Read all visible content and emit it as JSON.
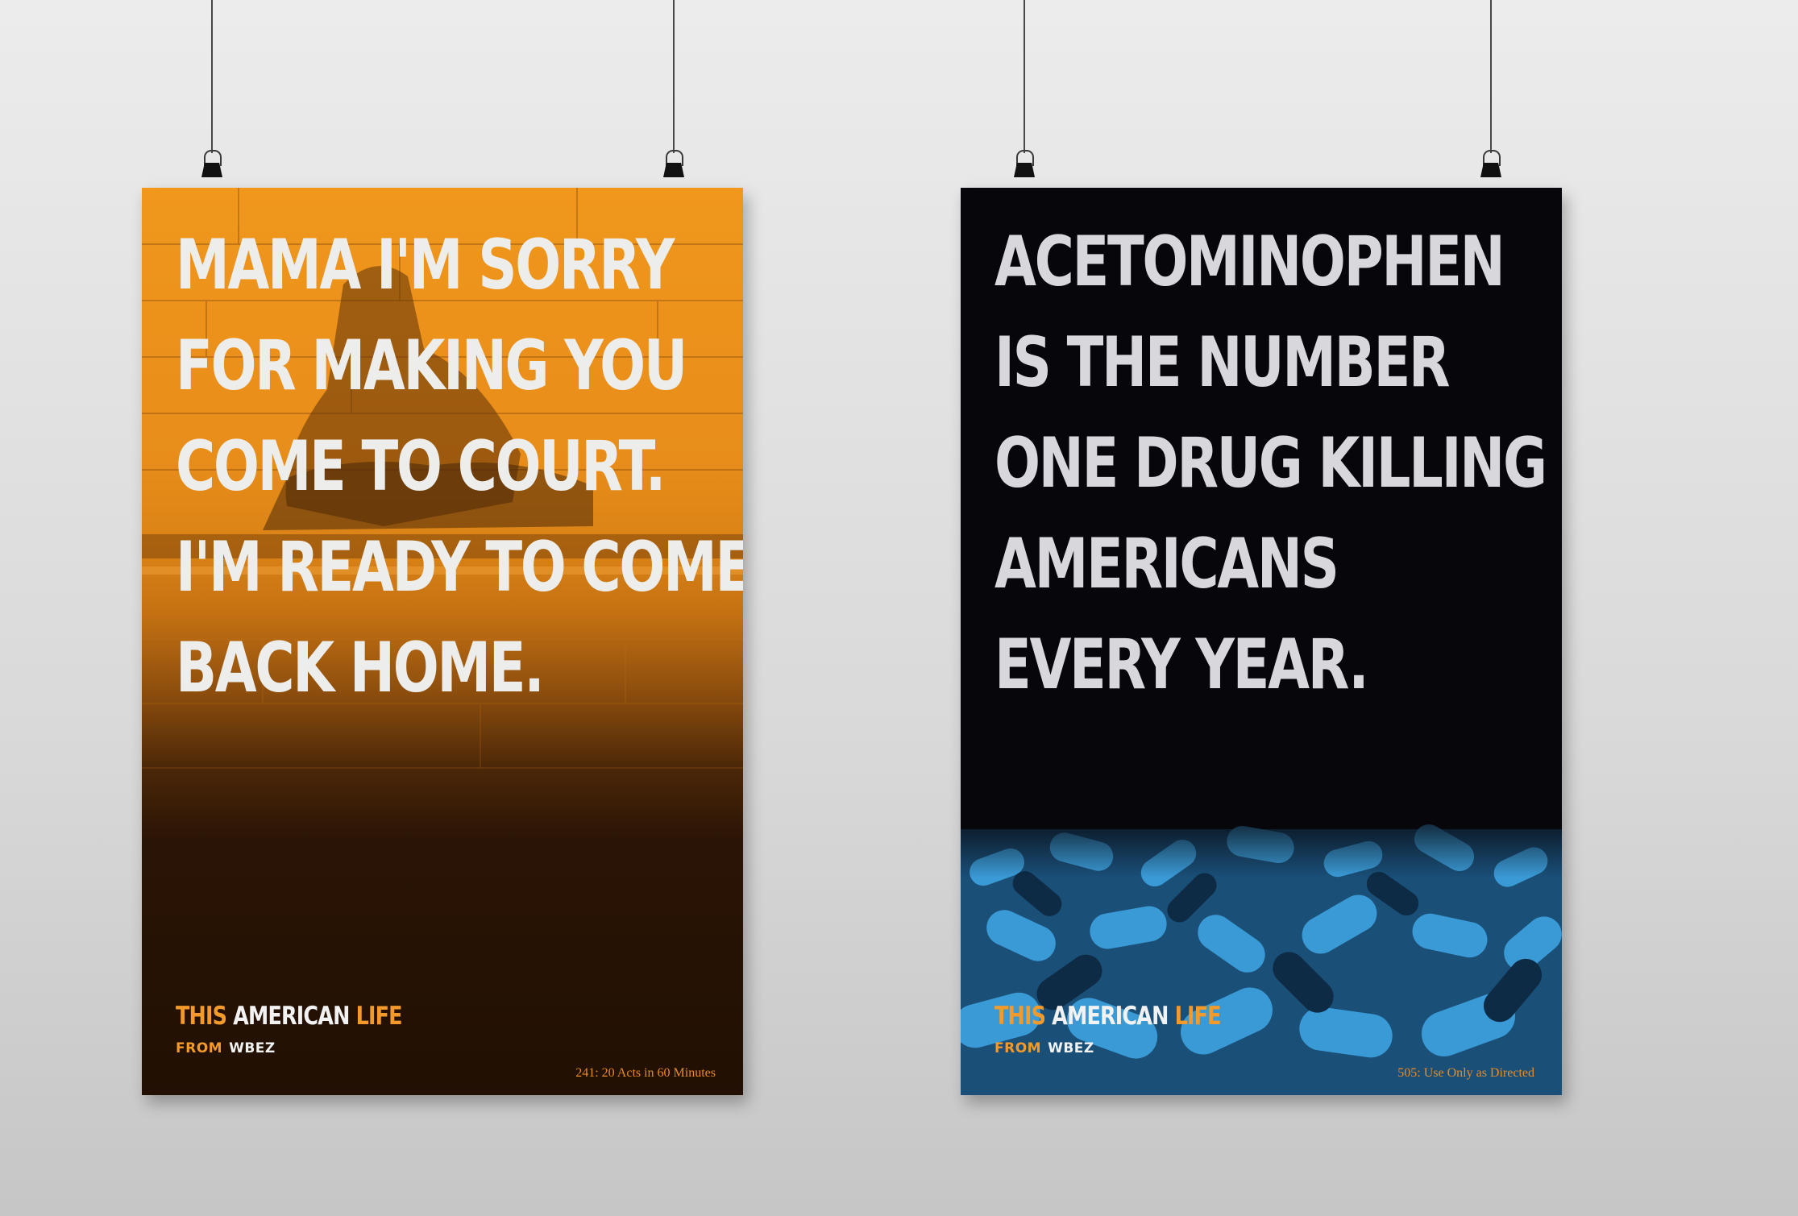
{
  "posters": [
    {
      "headline_lines": [
        "MAMA I'M SORRY",
        "FOR MAKING YOU",
        "COME TO COURT.",
        "I'M READY TO COME",
        "BACK HOME."
      ],
      "brand": {
        "this": "THIS",
        "american": "AMERICAN",
        "life": "LIFE",
        "from": "FROM",
        "station": "WBEZ"
      },
      "episode": "241: 20 Acts in 60 Minutes"
    },
    {
      "headline_lines": [
        "ACETOMINOPHEN",
        "IS THE NUMBER",
        "ONE DRUG KILLING",
        "AMERICANS",
        "EVERY YEAR."
      ],
      "brand": {
        "this": "THIS",
        "american": "AMERICAN",
        "life": "LIFE",
        "from": "FROM",
        "station": "WBEZ"
      },
      "episode": "505: Use Only as Directed"
    }
  ],
  "colors": {
    "orange_accent": "#f39a2a",
    "pill_blue": "#3a9ad6",
    "poster_left_dark": "#211003",
    "poster_right_bg": "#06060b",
    "background_gray": "#d9d9d9"
  }
}
